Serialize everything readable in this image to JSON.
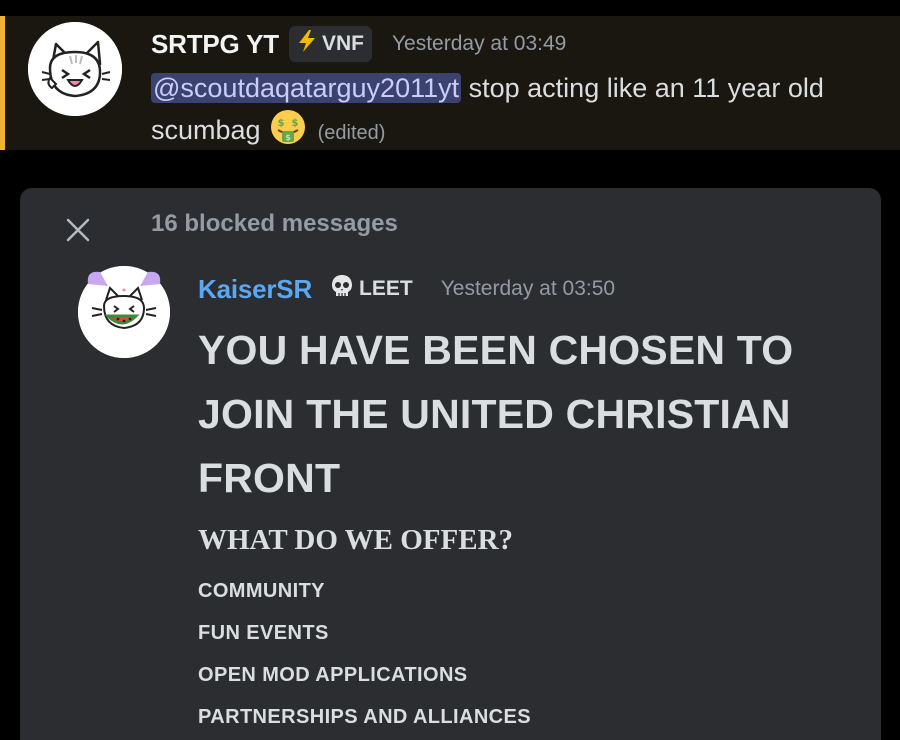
{
  "top_message": {
    "username": "SRTPG YT",
    "tag": {
      "label": "VNF",
      "icon": "lightning-icon"
    },
    "timestamp": "Yesterday at 03:49",
    "mention": "@scoutdaqatarguy2011yt",
    "text_line1": " stop acting like an 11 year old",
    "text_line2": "scumbag",
    "emoji": "money-mouth-face-emoji",
    "edited": "(edited)",
    "highlight_color": "#f0b232"
  },
  "blocked": {
    "label": "16 blocked messages",
    "message": {
      "username": "KaiserSR",
      "username_color": "#5aa7f2",
      "tag": {
        "label": "LEET",
        "icon": "skull-icon"
      },
      "timestamp": "Yesterday at 03:50",
      "heading": "YOU HAVE BEEN CHOSEN TO JOIN THE UNITED CHRISTIAN FRONT",
      "subheading": "WHAT DO WE OFFER?",
      "items": [
        "COMMUNITY",
        "FUN EVENTS",
        "OPEN MOD APPLICATIONS",
        "PARTNERSHIPS AND ALLIANCES"
      ]
    }
  }
}
